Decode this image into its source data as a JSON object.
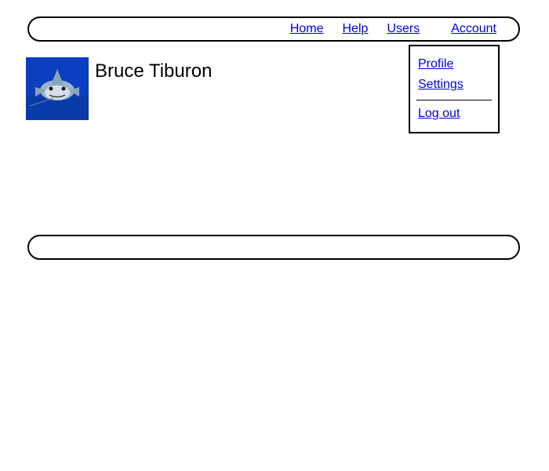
{
  "nav": {
    "home": "Home",
    "help": "Help",
    "users": "Users",
    "account": "Account"
  },
  "dropdown": {
    "profile": "Profile",
    "settings": "Settings",
    "logout": "Log out"
  },
  "user": {
    "name": "Bruce Tiburon",
    "avatar_alt": "shark-avatar"
  }
}
